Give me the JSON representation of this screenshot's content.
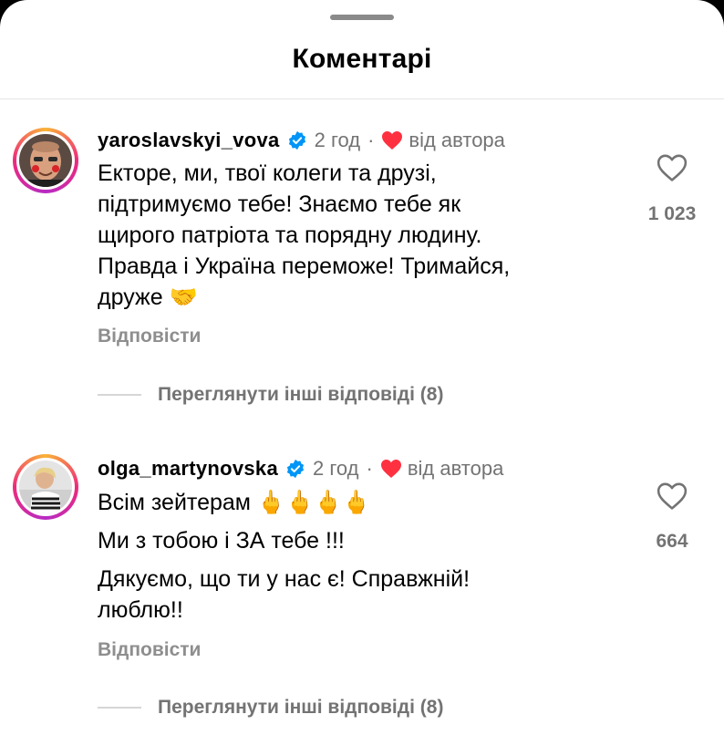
{
  "header": {
    "title": "Коментарі"
  },
  "comments": [
    {
      "username": "yaroslavskyi_vova",
      "time": "2 год",
      "separator": "·",
      "by_author": "від автора",
      "lines": [
        "Екторе, ми, твої колеги та друзі,",
        "підтримуємо тебе! Знаємо тебе як",
        "щирого патріота та порядну людину.",
        "Правда і Україна переможе! Тримайся,",
        "друже 🤝"
      ],
      "like_count": "1 023",
      "reply_label": "Відповісти",
      "view_replies": "Переглянути інші відповіді (8)"
    },
    {
      "username": "olga_martynovska",
      "time": "2 год",
      "separator": "·",
      "by_author": "від автора",
      "lines": [
        "Всім зейтерам 🖕🖕🖕🖕",
        "Ми з тобою і ЗА тебе !!!",
        "Дякуємо, що ти у нас є! Справжній!",
        "люблю!!"
      ],
      "like_count": "664",
      "reply_label": "Відповісти",
      "view_replies": "Переглянути інші відповіді (8)"
    }
  ],
  "colors": {
    "verified": "#0095f6",
    "author_heart": "#ff3040",
    "secondary_text": "#737373"
  },
  "icons": {
    "verified": "verified-badge-icon",
    "author_heart": "red-heart-icon",
    "like": "heart-outline-icon"
  }
}
